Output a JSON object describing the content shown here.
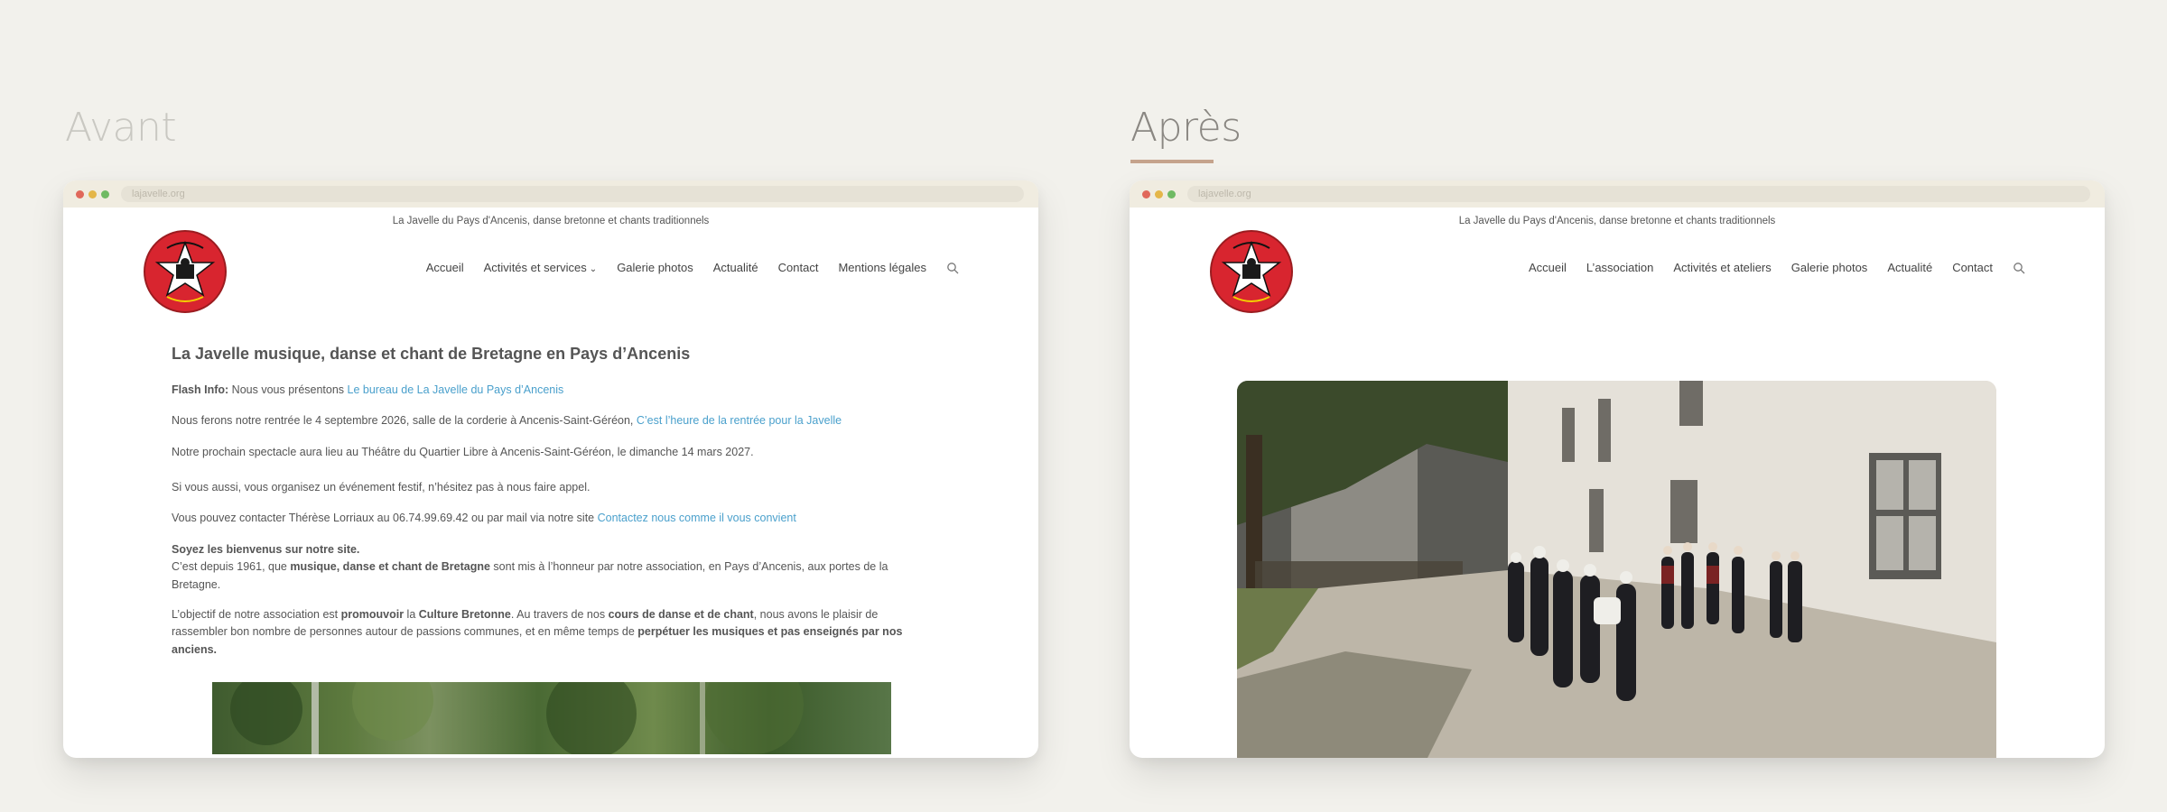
{
  "labels": {
    "before": "Avant",
    "after": "Après"
  },
  "colors": {
    "background": "#f2f1ec",
    "link": "#4aa0cc",
    "underline": "#c5a38c",
    "logo_red": "#d8252f"
  },
  "before": {
    "url": "lajavelle.org",
    "tagline": "La Javelle du Pays d'Ancenis, danse bretonne et chants traditionnels",
    "nav": [
      {
        "label": "Accueil"
      },
      {
        "label": "Activités et services"
      },
      {
        "label": "Galerie photos"
      },
      {
        "label": "Actualité"
      },
      {
        "label": "Contact"
      },
      {
        "label": "Mentions légales"
      }
    ],
    "title": "La Javelle musique, danse et chant de Bretagne en Pays d’Ancenis",
    "flash_label": "Flash Info:",
    "flash_text": " Nous vous présentons ",
    "flash_link": "Le bureau de La Javelle du Pays d’Ancenis",
    "rentree_text": "Nous ferons notre rentrée le 4 septembre 2026, salle de la corderie à Ancenis-Saint-Géréon, ",
    "rentree_link": "C’est l’heure de la rentrée pour la Javelle",
    "spectacle_text": "Notre prochain spectacle aura lieu au Théâtre du Quartier Libre à Ancenis-Saint-Géréon, le dimanche 14 mars 2027.",
    "event_text": "Si vous aussi, vous organisez un événement festif, n’hésitez pas à nous faire appel.",
    "contact_text": " Vous pouvez contacter Thérèse Lorriaux au 06.74.99.69.42 ou par mail via notre site ",
    "contact_link": "Contactez nous comme il vous convient",
    "welcome_bold": "Soyez les bienvenus sur notre site.",
    "history_1": "C’est depuis 1961, que ",
    "history_bold": "musique, danse et chant de Bretagne",
    "history_2": " sont mis à l’honneur par notre association, en Pays d’Ancenis, aux portes de la Bretagne.",
    "objective_1": "L’objectif de notre association est ",
    "objective_b1": "promouvoir",
    "objective_2": " la ",
    "objective_b2": "Culture Bretonne",
    "objective_3": ". Au travers de nos ",
    "objective_b3": "cours de danse et de chant",
    "objective_4": ", nous avons le plaisir de rassembler bon nombre de personnes autour de passions communes, et en même temps de ",
    "objective_b4": "perpétuer les musiques et pas enseignés par nos anciens."
  },
  "after": {
    "url": "lajavelle.org",
    "tagline": "La Javelle du Pays d'Ancenis, danse bretonne et chants traditionnels",
    "nav": [
      {
        "label": "Accueil"
      },
      {
        "label": "L’association"
      },
      {
        "label": "Activités et ateliers"
      },
      {
        "label": "Galerie photos"
      },
      {
        "label": "Actualité"
      },
      {
        "label": "Contact"
      }
    ]
  }
}
